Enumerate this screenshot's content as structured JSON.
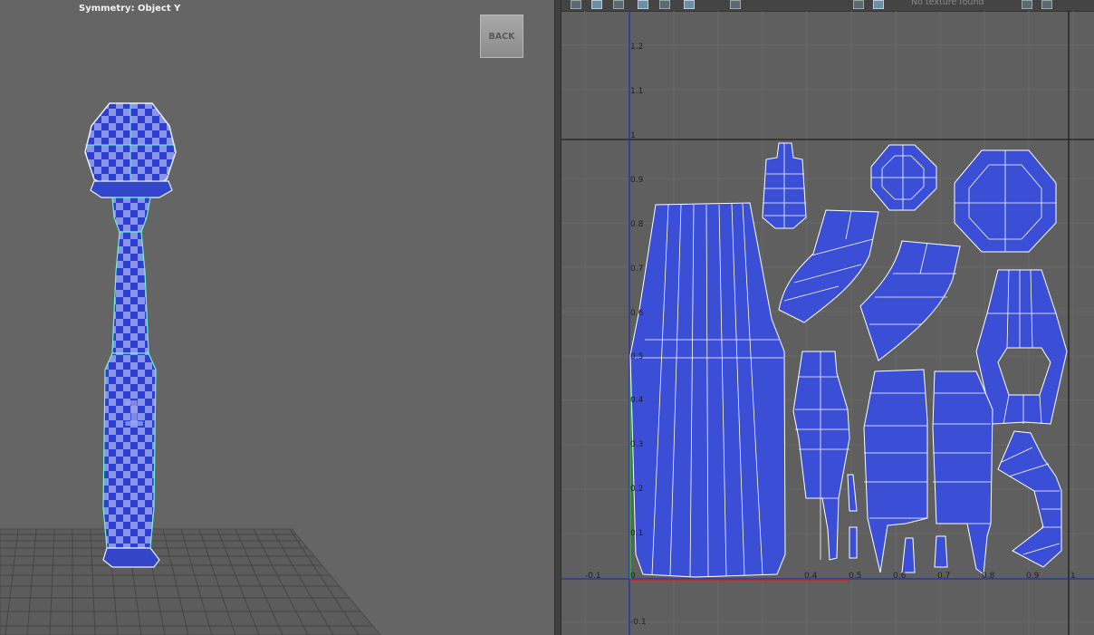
{
  "viewport": {
    "symmetry_label": "Symmetry: Object Y",
    "back_button": "BACK"
  },
  "uv_editor": {
    "toolbar_status": "No texture found",
    "axis_labels": {
      "v": [
        "1.2",
        "1.1",
        "1",
        "0.9",
        "0.8",
        "0.7",
        "0.6",
        "0.5",
        "0.4",
        "0.3",
        "0.2",
        "0.1",
        "-0.1"
      ],
      "u": [
        "-0.1",
        "0",
        "0.4",
        "0.5",
        "0.6",
        "0.7",
        "0.8",
        "0.9",
        "1"
      ]
    }
  },
  "colors": {
    "uv_shell_fill": "#3a4fd6",
    "uv_edge": "#ffffff",
    "viewport_bg": "#656565",
    "uv_bg": "#5f5f5f",
    "checker_light": "#8a94e8",
    "checker_dark": "#2c3fd0",
    "mesh_highlight": "#6ff2d6"
  }
}
